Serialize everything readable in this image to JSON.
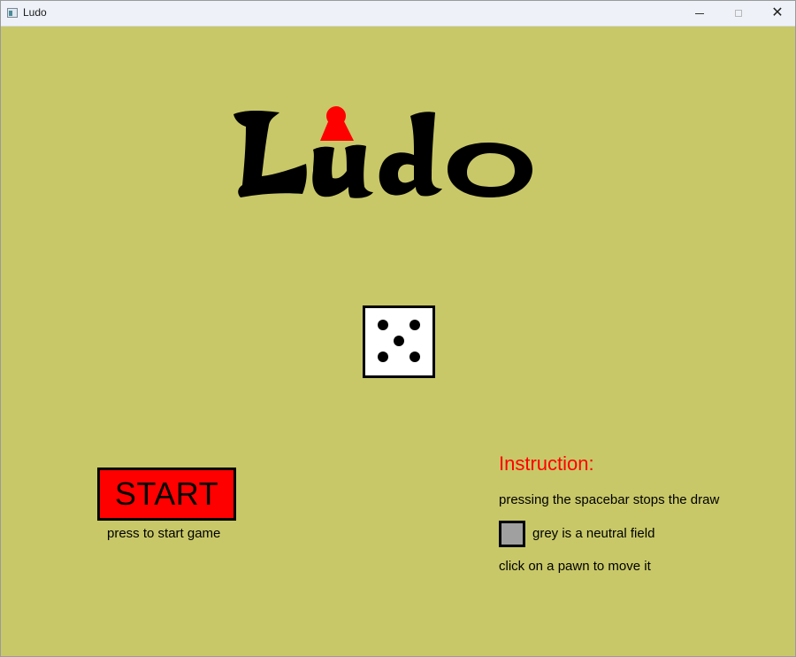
{
  "window": {
    "title": "Ludo",
    "controls": {
      "minimize_icon": "minimize-icon",
      "maximize_icon": "maximize-icon",
      "close_icon": "close-icon",
      "close_glyph": "✕"
    }
  },
  "logo": {
    "text": "Ludo",
    "pawn_color": "#ff0000"
  },
  "die": {
    "face_value": 5
  },
  "start": {
    "button_label": "START",
    "hint": "press to start game",
    "button_color": "#ff0000"
  },
  "instructions": {
    "title": "Instruction:",
    "line1": "pressing the spacebar stops the draw",
    "line2": "grey is a neutral field",
    "line3": "click on a pawn to move it",
    "neutral_color": "#a0a0a0",
    "title_color": "#ff0000"
  },
  "colors": {
    "background": "#c8c868"
  }
}
